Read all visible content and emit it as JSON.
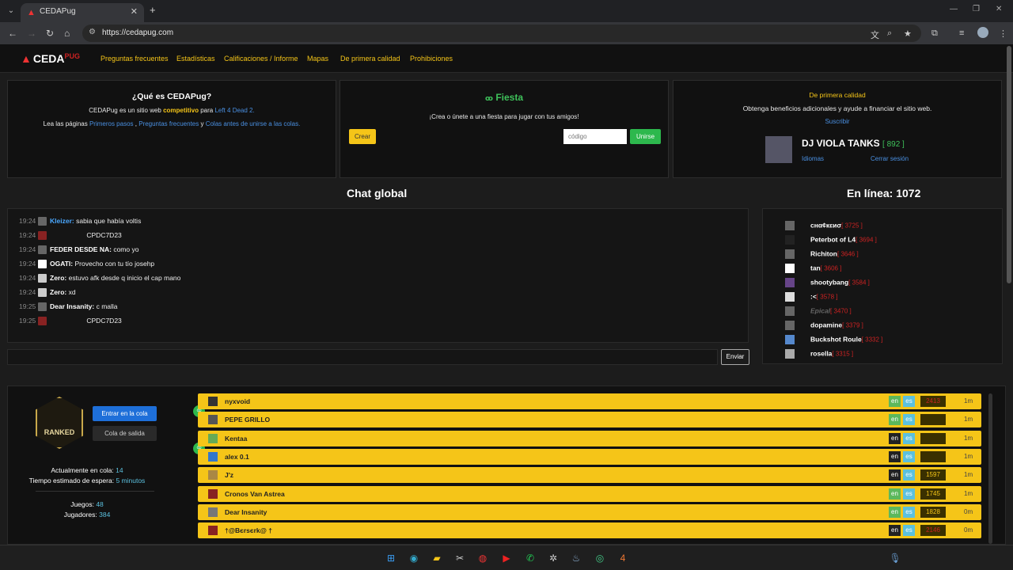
{
  "browser": {
    "tab_title": "CEDAPug",
    "url": "https://cedapug.com"
  },
  "nav": {
    "logo": "CEDA",
    "logo_suffix": "PUG",
    "links": [
      "Preguntas frecuentes",
      "Estadísticas",
      "Calificaciones / Informe",
      "Mapas",
      "De primera calidad",
      "Prohibiciones"
    ]
  },
  "about": {
    "title": "¿Qué es CEDAPug?",
    "line1_a": "CEDAPug es un sitio web ",
    "line1_b": "competitivo",
    "line1_c": " para ",
    "line1_d": "Left 4 Dead 2.",
    "line2_a": "Lea las páginas ",
    "line2_b": "Primeros pasos",
    "line2_c": " , ",
    "line2_d": "Preguntas frecuentes",
    "line2_e": " y ",
    "line2_f": "Colas antes de unirse a las colas."
  },
  "party": {
    "title": "Fiesta",
    "subtitle": "¡Crea o únete a una fiesta para jugar con tus amigos!",
    "create_label": "Crear",
    "code_placeholder": "código",
    "join_label": "Unirse"
  },
  "premium": {
    "title": "De primera calidad",
    "text": "Obtenga beneficios adicionales y ayude a financiar el sitio web.",
    "subscribe": "Suscribir",
    "user_name": "DJ VIOLA TANKS",
    "user_score": "[ 892 ]",
    "languages": "Idiomas",
    "logout": "Cerrar sesión"
  },
  "chat": {
    "title": "Chat global",
    "send_label": "Enviar",
    "messages": [
      {
        "time": "19:24",
        "name": "Kleizer:",
        "style": "blue",
        "msg": "sabia que había voltis"
      },
      {
        "time": "19:24",
        "name": "",
        "style": "red",
        "msg": "CPDC7D23"
      },
      {
        "time": "19:24",
        "name": "FEDER DESDE NA:",
        "style": "white",
        "msg": "como yo"
      },
      {
        "time": "19:24",
        "name": "OGATI:",
        "style": "white",
        "msg": "Provecho con tu tío josehp"
      },
      {
        "time": "19:24",
        "name": "Zero:",
        "style": "white",
        "msg": "estuvo afk desde q inicio el cap mano"
      },
      {
        "time": "19:24",
        "name": "Zero:",
        "style": "white",
        "msg": "xd"
      },
      {
        "time": "19:25",
        "name": "Dear Insanity:",
        "style": "white",
        "msg": "c malla"
      },
      {
        "time": "19:25",
        "name": "",
        "style": "red",
        "msg": "CPDC7D23"
      }
    ]
  },
  "online": {
    "title": "En línea: 1072",
    "users": [
      {
        "name": "cнα¢кεиσ",
        "score": "[ 3725 ]",
        "style": "white"
      },
      {
        "name": "Peterbot of L4",
        "score": "[ 3694 ]",
        "style": "white"
      },
      {
        "name": "Richiton",
        "score": "[ 3646 ]",
        "style": "white"
      },
      {
        "name": "tan",
        "score": "[ 3606 ]",
        "style": "white"
      },
      {
        "name": "shootybang",
        "score": "[ 3584 ]",
        "style": "white"
      },
      {
        "name": ":<",
        "score": "[ 3578 ]",
        "style": "white"
      },
      {
        "name": "Epical",
        "score": "[ 3470 ]",
        "style": "gray"
      },
      {
        "name": "dopamine",
        "score": "[ 3379 ]",
        "style": "white"
      },
      {
        "name": "Buckshot Roule",
        "score": "[ 3332 ]",
        "style": "white"
      },
      {
        "name": "rosella",
        "score": "[ 3315 ]",
        "style": "white"
      }
    ]
  },
  "queue": {
    "badge": "RANKED",
    "enter_label": "Entrar en la cola",
    "leave_label": "Cola de salida",
    "in_queue_label": "Actualmente en cola: ",
    "in_queue_value": "14",
    "wait_label": "Tiempo estimado de espera: ",
    "wait_value": "5 minutos",
    "games_label": "Juegos: ",
    "games_value": "48",
    "players_label": "Jugadores: ",
    "players_value": "384",
    "rows": [
      {
        "name": "nyxvoid",
        "en": "active",
        "mmr": "2413",
        "mmr_style": "red",
        "time": "1m"
      },
      {
        "name": "PEPE GRILLO",
        "en": "active",
        "mmr": "",
        "mmr_style": "",
        "time": "1m"
      },
      {
        "name": "Kentaa",
        "en": "dark",
        "mmr": "",
        "mmr_style": "",
        "time": "1m"
      },
      {
        "name": "alex 0.1",
        "en": "dark",
        "mmr": "",
        "mmr_style": "",
        "time": "1m"
      },
      {
        "name": "J'z",
        "en": "dark",
        "mmr": "1597",
        "mmr_style": "",
        "time": "1m"
      },
      {
        "name": "Cronos Van Astrea",
        "en": "active",
        "mmr": "1745",
        "mmr_style": "",
        "time": "1m"
      },
      {
        "name": "Dear Insanity",
        "en": "active",
        "mmr": "1828",
        "mmr_style": "",
        "time": "0m"
      },
      {
        "name": "†@Bєrsєrk@ †",
        "en": "dark",
        "mmr": "2146",
        "mmr_style": "red",
        "time": "0m"
      }
    ],
    "lang_en": "en",
    "lang_es": "es"
  }
}
